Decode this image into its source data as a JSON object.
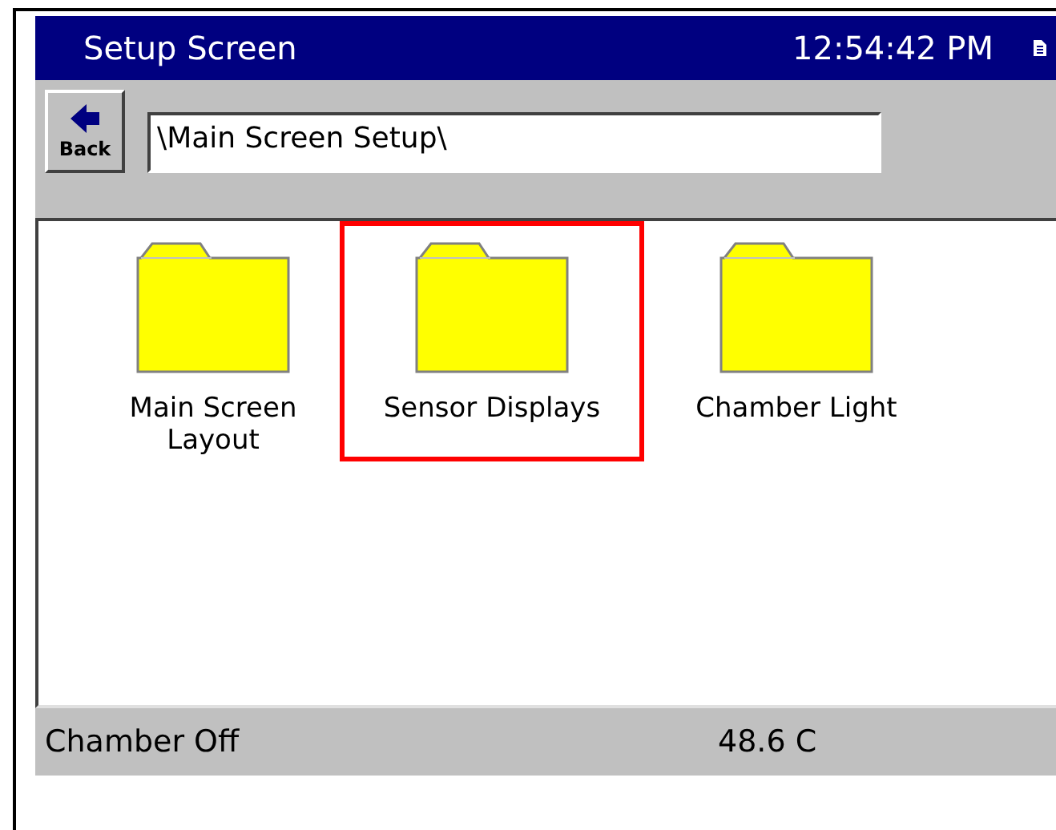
{
  "title_bar": {
    "title": "Setup Screen",
    "time": "12:54:42 PM"
  },
  "toolbar": {
    "back_label": "Back",
    "path": "\\Main Screen Setup\\"
  },
  "folders": [
    {
      "label": "Main Screen Layout",
      "selected": false
    },
    {
      "label": "Sensor Displays",
      "selected": true
    },
    {
      "label": "Chamber Light",
      "selected": false
    }
  ],
  "status_bar": {
    "status": "Chamber Off",
    "temperature": "48.6 C"
  }
}
